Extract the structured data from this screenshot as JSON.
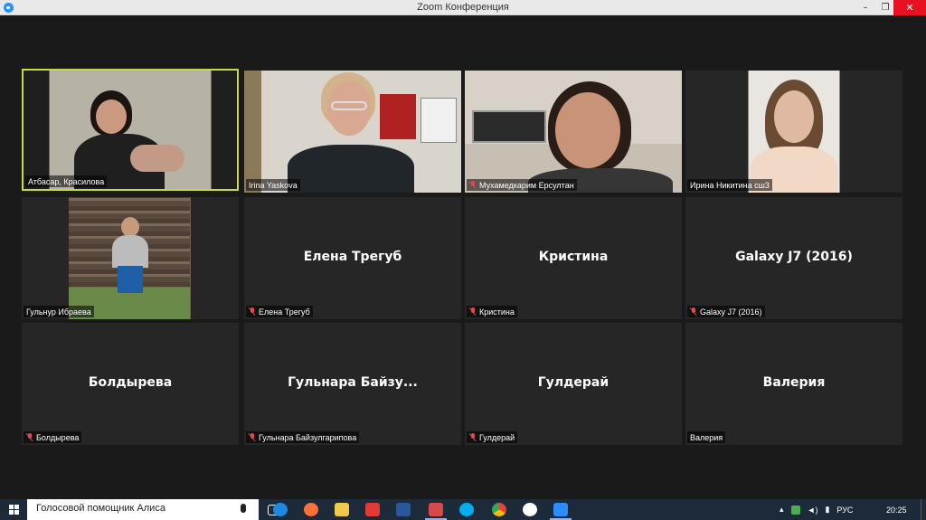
{
  "window": {
    "title": "Zoom Конференция",
    "minimize_icon": "minimize-icon",
    "maximize_icon": "restore-icon",
    "close_icon": "close-icon",
    "min_glyph": "–",
    "max_glyph": "❐",
    "close_glyph": "✕"
  },
  "participants": [
    {
      "name": "Атбасар, Красилова",
      "video": true,
      "muted": false,
      "active_speaker": true
    },
    {
      "name": "Irina Yaskova",
      "video": true,
      "muted": false
    },
    {
      "name": "Мухамедкарим Ерсултан",
      "video": true,
      "muted": true
    },
    {
      "name": "Ирина Никитина сш3",
      "video": true,
      "muted": false
    },
    {
      "name": "Гульнур Ибраева",
      "video": true,
      "muted": false
    },
    {
      "name": "Елена Трегуб",
      "display_name": "Елена Трегуб",
      "video": false,
      "muted": true
    },
    {
      "name": "Кристина",
      "display_name": "Кристина",
      "video": false,
      "muted": true
    },
    {
      "name": "Galaxy J7 (2016)",
      "display_name": "Galaxy J7 (2016)",
      "video": false,
      "muted": true
    },
    {
      "name": "Болдырева",
      "display_name": "Болдырева",
      "video": false,
      "muted": true
    },
    {
      "name": "Гульнара Байзулгарипова",
      "display_name": "Гульнара  Байзу...",
      "video": false,
      "muted": true
    },
    {
      "name": "Гулдерай",
      "display_name": "Гулдерай",
      "video": false,
      "muted": true
    },
    {
      "name": "Валерия",
      "display_name": "Валерия",
      "video": false,
      "muted": false
    }
  ],
  "colors": {
    "background": "#1a1a1a",
    "tile": "#262626",
    "active_border": "#c8d94a",
    "muted": "#e24a4a"
  },
  "taskbar": {
    "search_placeholder": "Голосовой помощник Алиса",
    "apps": [
      "task-view-icon",
      "edge-icon",
      "firefox-icon",
      "file-explorer-icon",
      "yandex-icon",
      "word-icon",
      "calendar-icon",
      "skype-icon",
      "chrome-icon",
      "yandex-browser-icon",
      "zoom-icon"
    ],
    "language": "РУС",
    "time": "20:25"
  }
}
